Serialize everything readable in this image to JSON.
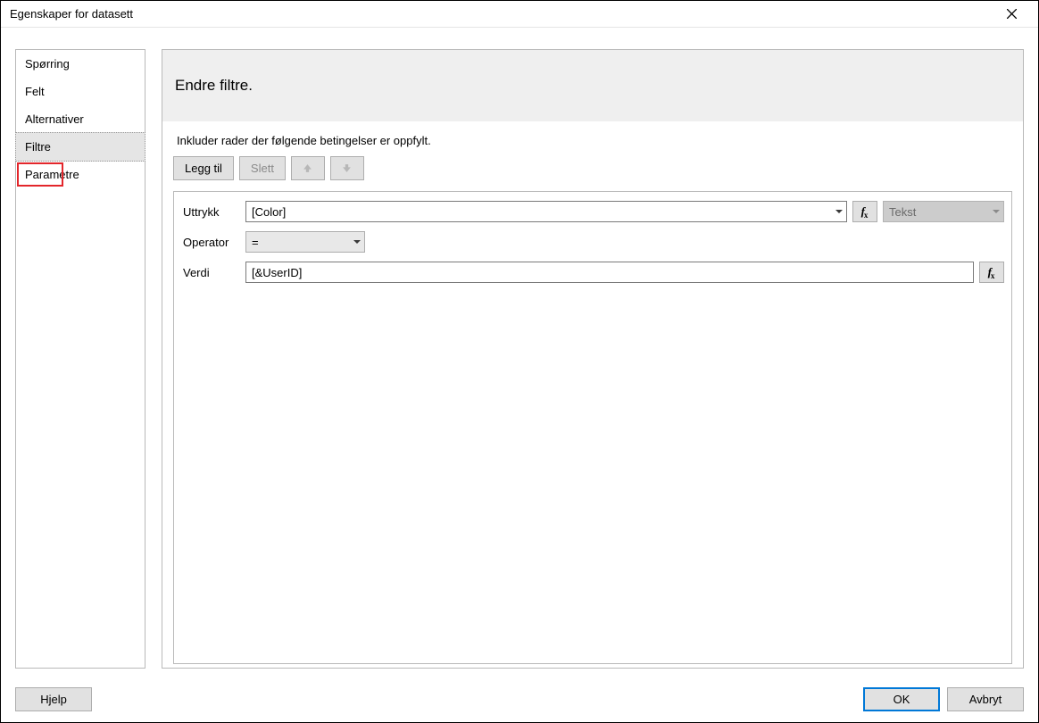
{
  "window": {
    "title": "Egenskaper for datasett"
  },
  "sidebar": {
    "items": [
      {
        "label": "Spørring"
      },
      {
        "label": "Felt"
      },
      {
        "label": "Alternativer"
      },
      {
        "label": "Filtre"
      },
      {
        "label": "Parametre"
      }
    ],
    "active_index": 3
  },
  "main": {
    "heading": "Endre filtre.",
    "instruction": "Inkluder rader der følgende betingelser er oppfylt.",
    "toolbar": {
      "add_label": "Legg til",
      "delete_label": "Slett",
      "move_up_icon": "arrow-up-icon",
      "move_down_icon": "arrow-down-icon"
    },
    "filter": {
      "expression_label": "Uttrykk",
      "expression_value": "[Color]",
      "type_label": "Tekst",
      "operator_label": "Operator",
      "operator_value": "=",
      "value_label": "Verdi",
      "value_value": "[&UserID]",
      "fx_label": "fx"
    }
  },
  "footer": {
    "help_label": "Hjelp",
    "ok_label": "OK",
    "cancel_label": "Avbryt"
  }
}
